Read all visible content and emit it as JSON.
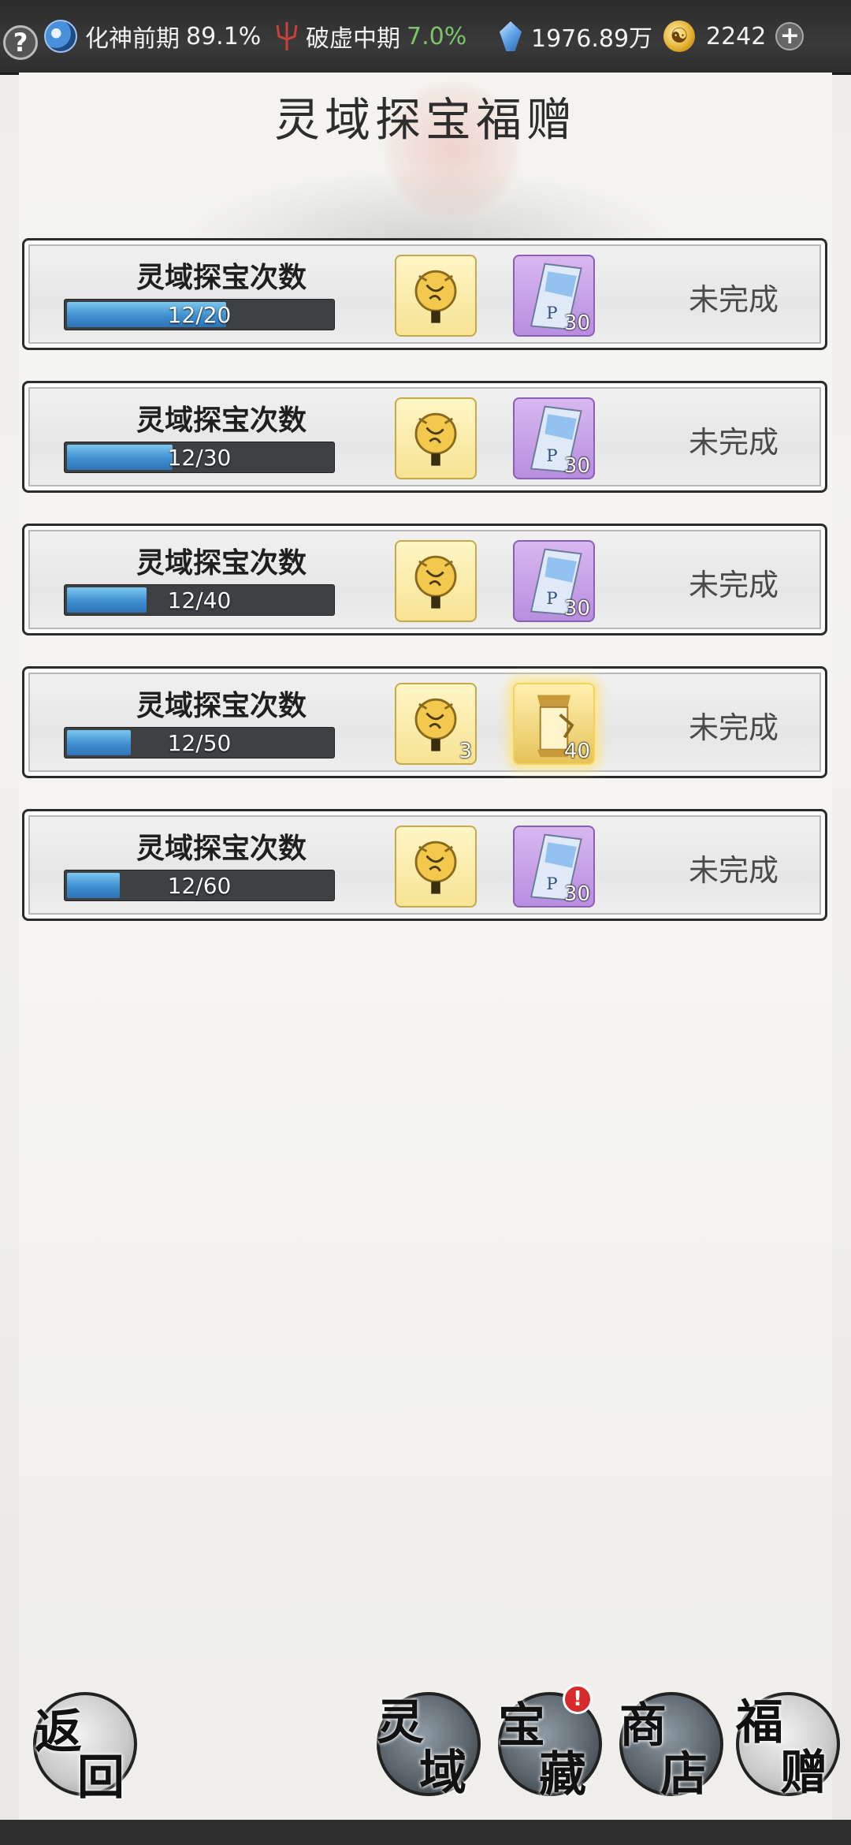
{
  "topbar": {
    "help_label": "?",
    "realm_name": "化神前期",
    "realm_progress": "89.1%",
    "break_name": "破虚中期",
    "break_progress": "7.0%",
    "spirit_stones": "1976.89万",
    "coins": "2242",
    "plus_label": "+"
  },
  "page": {
    "title": "灵域探宝福赠"
  },
  "tasks": [
    {
      "label": "灵域探宝次数",
      "progress_text": "12/20",
      "progress_fraction": 0.6,
      "reward1_count": "",
      "reward2_type": "scroll",
      "reward2_count": "30",
      "status": "未完成"
    },
    {
      "label": "灵域探宝次数",
      "progress_text": "12/30",
      "progress_fraction": 0.4,
      "reward1_count": "",
      "reward2_type": "scroll",
      "reward2_count": "30",
      "status": "未完成"
    },
    {
      "label": "灵域探宝次数",
      "progress_text": "12/40",
      "progress_fraction": 0.3,
      "reward1_count": "",
      "reward2_type": "scroll",
      "reward2_count": "30",
      "status": "未完成"
    },
    {
      "label": "灵域探宝次数",
      "progress_text": "12/50",
      "progress_fraction": 0.24,
      "reward1_count": "3",
      "reward2_type": "golden",
      "reward2_count": "40",
      "status": "未完成"
    },
    {
      "label": "灵域探宝次数",
      "progress_text": "12/60",
      "progress_fraction": 0.2,
      "reward1_count": "",
      "reward2_type": "scroll",
      "reward2_count": "30",
      "status": "未完成"
    }
  ],
  "nav": {
    "back": [
      "返",
      "回"
    ],
    "realm": [
      "灵",
      "域"
    ],
    "treasure": [
      "宝",
      "藏"
    ],
    "treasure_badge": "!",
    "shop": [
      "商",
      "店"
    ],
    "gift": [
      "福",
      "赠"
    ]
  },
  "icons": {
    "help": "help-icon",
    "realm": "taichi-icon",
    "break": "trident-icon",
    "spirit_stone": "gem-icon",
    "coin": "coin-icon",
    "add": "plus-icon",
    "reward_lantern": "lantern-icon",
    "reward_scroll": "scroll-icon",
    "reward_golden": "golden-scroll-icon"
  },
  "colors": {
    "bar_fill": "#3f8fd0",
    "progress_green": "#7cc36b",
    "badge_red": "#d82a2a"
  }
}
